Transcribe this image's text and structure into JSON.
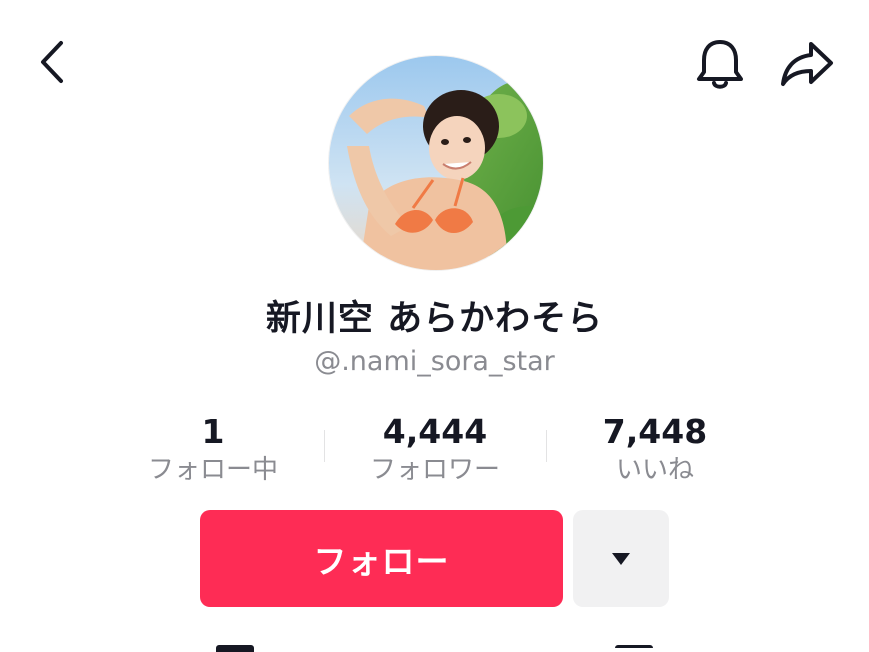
{
  "header": {
    "back_icon": "chevron-left-icon",
    "notification_icon": "bell-icon",
    "share_icon": "share-arrow-icon"
  },
  "profile": {
    "avatar_description_icon": "profile-avatar",
    "display_name": "新川空 あらかわそら",
    "username": "@.nami_sora_star"
  },
  "stats": [
    {
      "value": "1",
      "label": "フォロー中"
    },
    {
      "value": "4,444",
      "label": "フォロワー"
    },
    {
      "value": "7,448",
      "label": "いいね"
    }
  ],
  "actions": {
    "follow_label": "フォロー",
    "more_icon": "caret-down-icon"
  },
  "colors": {
    "accent": "#fe2c55",
    "text_primary": "#161823",
    "text_secondary": "#8a8b91",
    "secondary_button_bg": "#f1f1f2"
  }
}
